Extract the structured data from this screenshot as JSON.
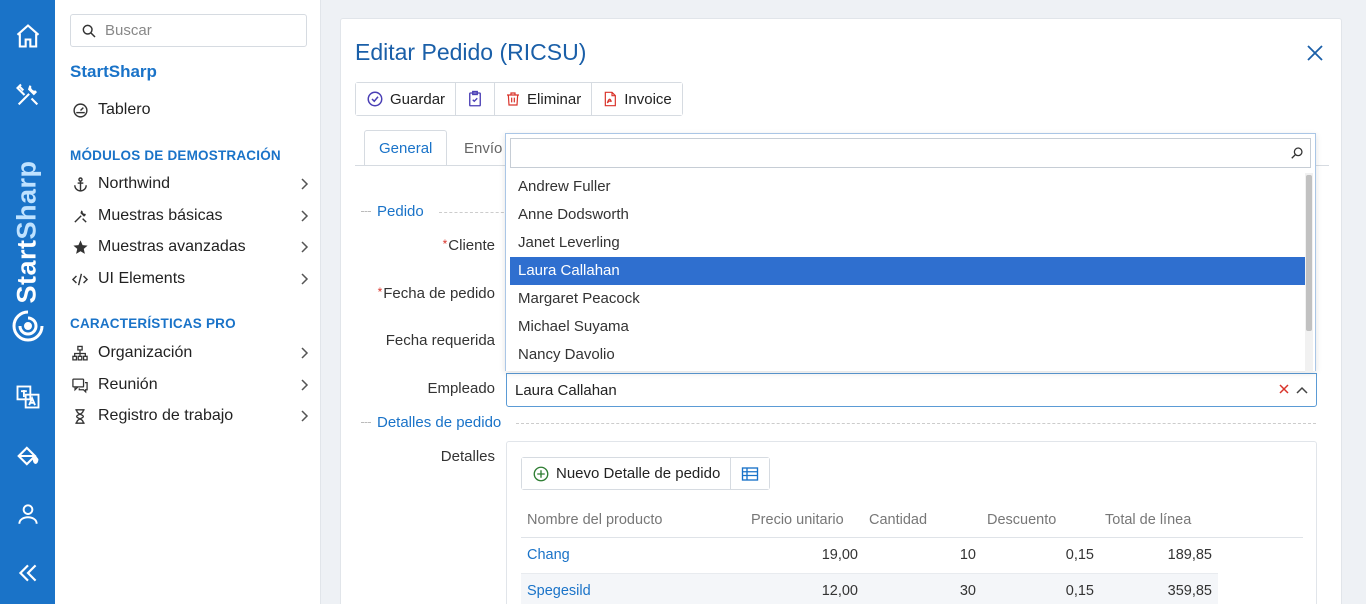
{
  "rail": {
    "brand_start": "Start",
    "brand_sharp": "Sharp",
    "icons": [
      "home-icon",
      "tools-icon",
      "translate-icon",
      "paint-bucket-icon",
      "user-icon",
      "collapse-icon"
    ]
  },
  "sidebar": {
    "search_placeholder": "Buscar",
    "app_name": "StartSharp",
    "dashboard": "Tablero",
    "section_demo": "MÓDULOS DE DEMOSTRACIÓN",
    "demo_items": [
      {
        "label": "Northwind",
        "icon": "anchor-icon"
      },
      {
        "label": "Muestras básicas",
        "icon": "tools-icon"
      },
      {
        "label": "Muestras avanzadas",
        "icon": "star-icon"
      },
      {
        "label": "UI Elements",
        "icon": "code-icon"
      }
    ],
    "section_pro": "CARACTERÍSTICAS PRO",
    "pro_items": [
      {
        "label": "Organización",
        "icon": "org-chart-icon"
      },
      {
        "label": "Reunión",
        "icon": "chat-icon"
      },
      {
        "label": "Registro de trabajo",
        "icon": "hourglass-icon"
      }
    ]
  },
  "dialog": {
    "title": "Editar Pedido (RICSU)",
    "toolbar": {
      "save": "Guardar",
      "delete": "Eliminar",
      "invoice": "Invoice"
    },
    "tabs": [
      "General",
      "Envío"
    ],
    "category_order": "Pedido",
    "labels": {
      "customer": "Cliente",
      "order_date": "Fecha de pedido",
      "required_date": "Fecha requerida",
      "employee": "Empleado",
      "details": "Detalles"
    },
    "required_mark": "*",
    "employee_value": "Laura Callahan",
    "dropdown": {
      "search_value": "",
      "options": [
        "Andrew Fuller",
        "Anne Dodsworth",
        "Janet Leverling",
        "Laura Callahan",
        "Margaret Peacock",
        "Michael Suyama",
        "Nancy Davolio"
      ],
      "selected": "Laura Callahan"
    },
    "category_details": "Detalles de pedido",
    "details_toolbar": {
      "new_detail": "Nuevo Detalle de pedido"
    },
    "grid": {
      "columns": [
        "Nombre del producto",
        "Precio unitario",
        "Cantidad",
        "Descuento",
        "Total de línea"
      ],
      "rows": [
        {
          "product": "Chang",
          "unit_price": "19,00",
          "quantity": "10",
          "discount": "0,15",
          "line_total": "189,85"
        },
        {
          "product": "Spegesild",
          "unit_price": "12,00",
          "quantity": "30",
          "discount": "0,15",
          "line_total": "359,85"
        }
      ]
    }
  }
}
